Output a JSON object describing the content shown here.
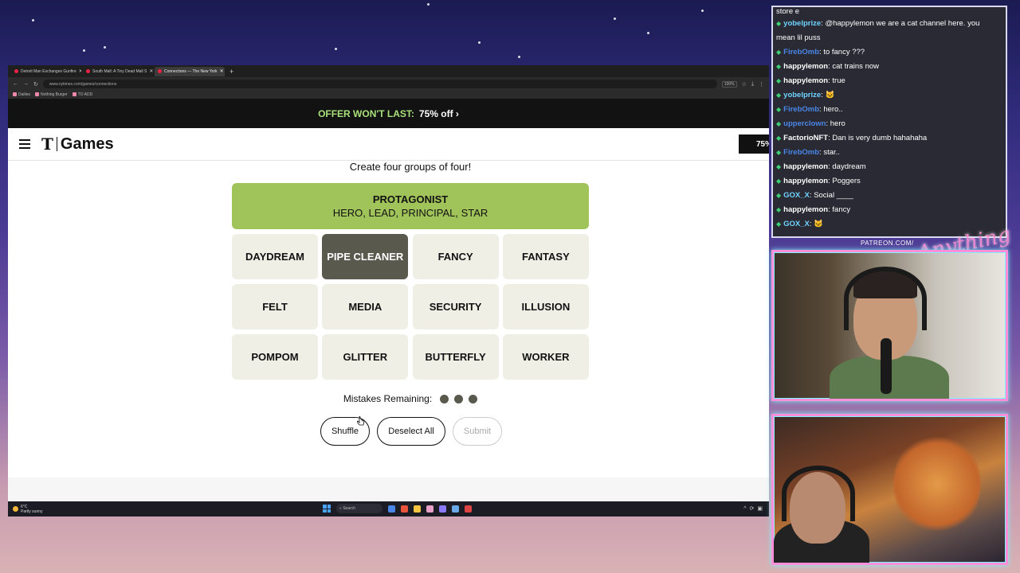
{
  "browser": {
    "tabs": [
      {
        "title": "Detroit Man Exchanges Gunfire",
        "active": false
      },
      {
        "title": "South Mall: A Tiny Dead Mall S",
        "active": false
      },
      {
        "title": "Connections — The New York",
        "active": true
      }
    ],
    "url": "www.nytimes.com/games/connections",
    "zoom": "100%",
    "bookmarks": [
      "Dailies",
      "Nothing Burger",
      "TO ADD"
    ]
  },
  "offer": {
    "lead": "OFFER WON'T LAST:",
    "deal": "75% off ›"
  },
  "header": {
    "brand_t": "T",
    "brand_games": "Games",
    "subscribe_label": "75%"
  },
  "game": {
    "instructions": "Create four groups of four!",
    "solved": [
      {
        "category": "PROTAGONIST",
        "members": "HERO, LEAD, PRINCIPAL, STAR",
        "color": "#a0c35a"
      }
    ],
    "cards": [
      {
        "word": "DAYDREAM",
        "selected": false
      },
      {
        "word": "PIPE CLEANER",
        "selected": true
      },
      {
        "word": "FANCY",
        "selected": false
      },
      {
        "word": "FANTASY",
        "selected": false
      },
      {
        "word": "FELT",
        "selected": false
      },
      {
        "word": "MEDIA",
        "selected": false
      },
      {
        "word": "SECURITY",
        "selected": false
      },
      {
        "word": "ILLUSION",
        "selected": false
      },
      {
        "word": "POMPOM",
        "selected": false
      },
      {
        "word": "GLITTER",
        "selected": false
      },
      {
        "word": "BUTTERFLY",
        "selected": false
      },
      {
        "word": "WORKER",
        "selected": false
      }
    ],
    "mistakes_label": "Mistakes Remaining:",
    "mistakes_remaining": 3,
    "buttons": {
      "shuffle": "Shuffle",
      "deselect": "Deselect All",
      "submit": "Submit"
    }
  },
  "taskbar": {
    "weather_temp": "6°C",
    "weather_desc": "Partly sunny",
    "search_placeholder": "Search"
  },
  "chat": {
    "top_continuation": "store e",
    "messages": [
      {
        "user": "yobelprize",
        "color": "#6fd3ff",
        "text": "@happylemon we are a cat channel here. you"
      },
      {
        "user": "",
        "color": "#ffffff",
        "text": "mean lil puss"
      },
      {
        "user": "FirebOmb",
        "color": "#4a86e8",
        "text": "to fancy ???"
      },
      {
        "user": "happylemon",
        "color": "#ffffff",
        "text": "cat trains now"
      },
      {
        "user": "happylemon",
        "color": "#ffffff",
        "text": "true"
      },
      {
        "user": "yobelprize",
        "color": "#6fd3ff",
        "text": "🐱"
      },
      {
        "user": "FirebOmb",
        "color": "#4a86e8",
        "text": "hero.."
      },
      {
        "user": "upperclown",
        "color": "#4a86e8",
        "text": "hero"
      },
      {
        "user": "FactorioNFT",
        "color": "#ffffff",
        "text": "Dan is very dumb hahahaha"
      },
      {
        "user": "FirebOmb",
        "color": "#4a86e8",
        "text": "star.."
      },
      {
        "user": "happylemon",
        "color": "#ffffff",
        "text": "daydream"
      },
      {
        "user": "happylemon",
        "color": "#ffffff",
        "text": "Poggers"
      },
      {
        "user": "GOX_X",
        "color": "#6fd3ff",
        "text": "Social ____"
      },
      {
        "user": "happylemon",
        "color": "#ffffff",
        "text": "fancy"
      },
      {
        "user": "GOX_X",
        "color": "#6fd3ff",
        "text": "🐱"
      }
    ]
  },
  "overlay": {
    "patreon": "PATREON.COM/"
  }
}
